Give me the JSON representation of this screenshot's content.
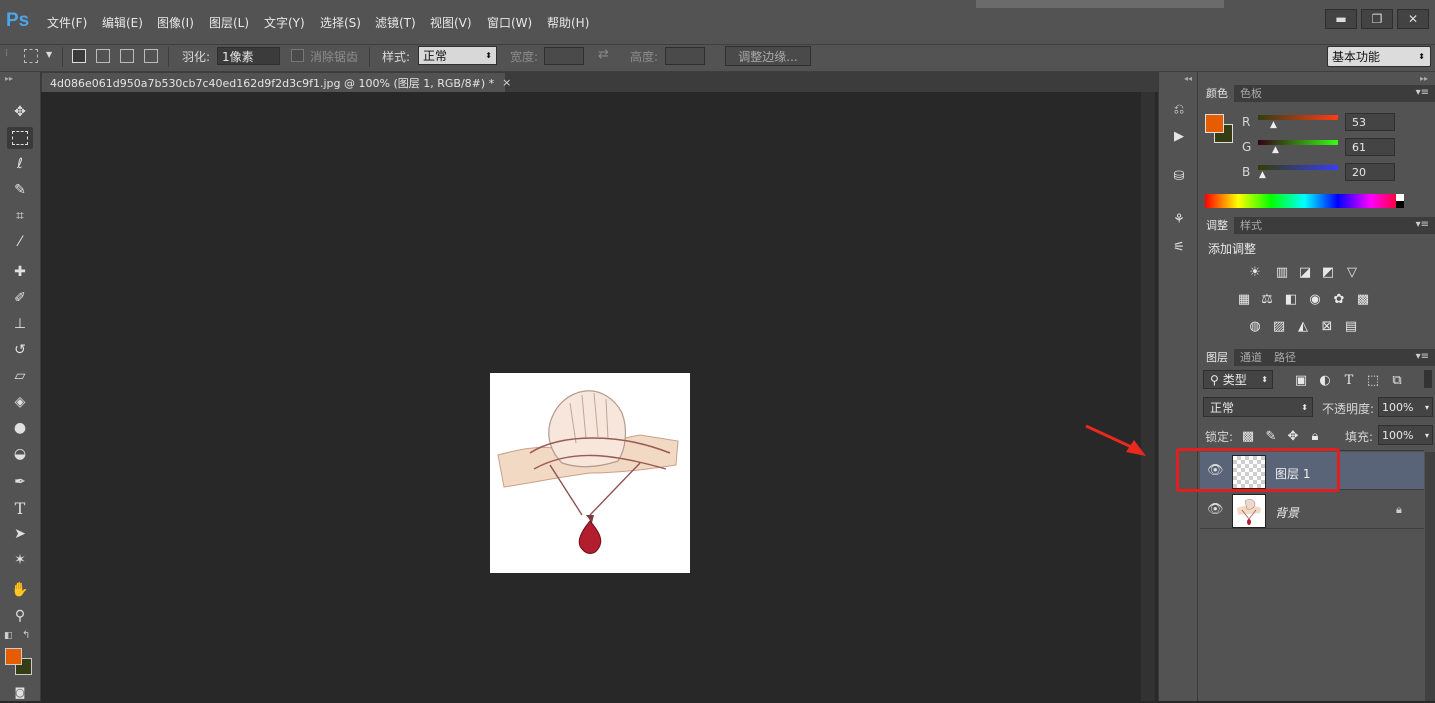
{
  "app": {
    "logo": "Ps"
  },
  "menu": [
    {
      "label": "文件(F)",
      "key": "file"
    },
    {
      "label": "编辑(E)",
      "key": "edit"
    },
    {
      "label": "图像(I)",
      "key": "image"
    },
    {
      "label": "图层(L)",
      "key": "layer"
    },
    {
      "label": "文字(Y)",
      "key": "type"
    },
    {
      "label": "选择(S)",
      "key": "select"
    },
    {
      "label": "滤镜(T)",
      "key": "filter"
    },
    {
      "label": "视图(V)",
      "key": "view"
    },
    {
      "label": "窗口(W)",
      "key": "window"
    },
    {
      "label": "帮助(H)",
      "key": "help"
    }
  ],
  "options_bar": {
    "feather_label": "羽化:",
    "feather_value": "1像素",
    "antialias_label": "消除锯齿",
    "style_label": "样式:",
    "style_value": "正常",
    "width_label": "宽度:",
    "height_label": "高度:",
    "refine_edge_button": "调整边缘...",
    "workspace": "基本功能"
  },
  "document_tab": {
    "title": "4d086e061d950a7b530cb7c40ed162d9f2d3c9f1.jpg @ 100% (图层 1, RGB/8#) *",
    "close": "×"
  },
  "color_panel": {
    "tabs": [
      "颜色",
      "色板"
    ],
    "foreground": "#e65c00",
    "background": "#353d14",
    "channels": [
      {
        "name": "R",
        "value": "53"
      },
      {
        "name": "G",
        "value": "61"
      },
      {
        "name": "B",
        "value": "20"
      }
    ]
  },
  "adjustments_panel": {
    "tabs": [
      "调整",
      "样式"
    ],
    "heading": "添加调整"
  },
  "layers_panel": {
    "tabs": [
      "图层",
      "通道",
      "路径"
    ],
    "filter_label": "类型",
    "blend_mode": "正常",
    "opacity_label": "不透明度:",
    "opacity_value": "100%",
    "lock_label": "锁定:",
    "fill_label": "填充:",
    "fill_value": "100%",
    "layers": [
      {
        "name": "图层 1",
        "selected": true
      },
      {
        "name": "背景",
        "selected": false
      }
    ]
  },
  "colors": {
    "highlight_box": "#e02020",
    "selected_layer": "#5a6478"
  }
}
